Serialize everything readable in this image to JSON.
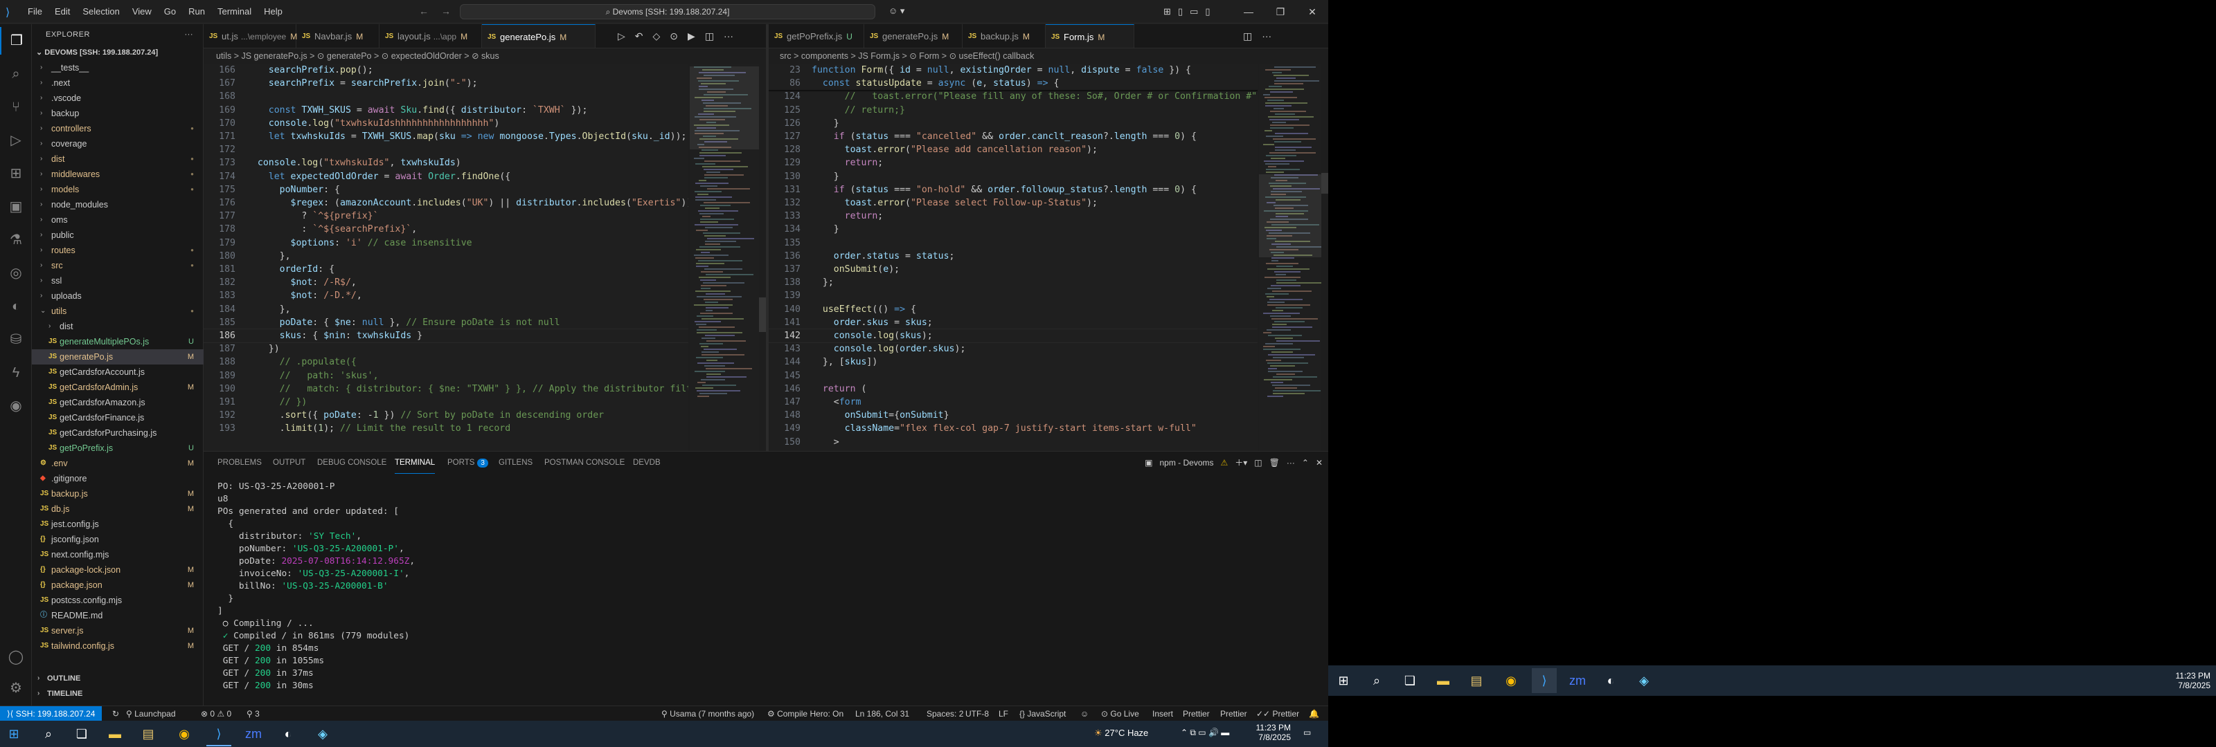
{
  "titlebar": {
    "menu": [
      "File",
      "Edit",
      "Selection",
      "View",
      "Go",
      "Run",
      "Terminal",
      "Help"
    ],
    "command_center": "Devoms [SSH: 199.188.207.24]"
  },
  "sidebar": {
    "title": "EXPLORER",
    "root": "DEVOMS [SSH: 199.188.207.24]",
    "items": [
      {
        "name": "__tests__",
        "type": "folder",
        "depth": 0,
        "badge": ""
      },
      {
        "name": ".next",
        "type": "folder",
        "depth": 0,
        "badge": ""
      },
      {
        "name": ".vscode",
        "type": "folder",
        "depth": 0,
        "badge": ""
      },
      {
        "name": "backup",
        "type": "folder",
        "depth": 0,
        "badge": ""
      },
      {
        "name": "controllers",
        "type": "folder",
        "depth": 0,
        "badge": "dot"
      },
      {
        "name": "coverage",
        "type": "folder",
        "depth": 0,
        "badge": ""
      },
      {
        "name": "dist",
        "type": "folder",
        "depth": 0,
        "badge": "dot"
      },
      {
        "name": "middlewares",
        "type": "folder",
        "depth": 0,
        "badge": "dot"
      },
      {
        "name": "models",
        "type": "folder",
        "depth": 0,
        "badge": "dot"
      },
      {
        "name": "node_modules",
        "type": "folder",
        "depth": 0,
        "badge": ""
      },
      {
        "name": "oms",
        "type": "folder",
        "depth": 0,
        "badge": ""
      },
      {
        "name": "public",
        "type": "folder",
        "depth": 0,
        "badge": ""
      },
      {
        "name": "routes",
        "type": "folder",
        "depth": 0,
        "badge": "dot"
      },
      {
        "name": "src",
        "type": "folder",
        "depth": 0,
        "badge": "dot"
      },
      {
        "name": "ssl",
        "type": "folder",
        "depth": 0,
        "badge": ""
      },
      {
        "name": "uploads",
        "type": "folder",
        "depth": 0,
        "badge": ""
      },
      {
        "name": "utils",
        "type": "folder-open",
        "depth": 0,
        "badge": "dot"
      },
      {
        "name": "dist",
        "type": "folder",
        "depth": 1,
        "badge": ""
      },
      {
        "name": "generateMultiplePOs.js",
        "type": "js",
        "depth": 1,
        "badge": "U"
      },
      {
        "name": "generatePo.js",
        "type": "js",
        "depth": 1,
        "badge": "M"
      },
      {
        "name": "getCardsforAccount.js",
        "type": "js",
        "depth": 1,
        "badge": ""
      },
      {
        "name": "getCardsforAdmin.js",
        "type": "js",
        "depth": 1,
        "badge": "M"
      },
      {
        "name": "getCardsforAmazon.js",
        "type": "js",
        "depth": 1,
        "badge": ""
      },
      {
        "name": "getCardsforFinance.js",
        "type": "js",
        "depth": 1,
        "badge": ""
      },
      {
        "name": "getCardsforPurchasing.js",
        "type": "js",
        "depth": 1,
        "badge": ""
      },
      {
        "name": "getPoPrefix.js",
        "type": "js",
        "depth": 1,
        "badge": "U"
      },
      {
        "name": ".env",
        "type": "env",
        "depth": 0,
        "badge": "M"
      },
      {
        "name": ".gitignore",
        "type": "git",
        "depth": 0,
        "badge": ""
      },
      {
        "name": "backup.js",
        "type": "js",
        "depth": 0,
        "badge": "M"
      },
      {
        "name": "db.js",
        "type": "js",
        "depth": 0,
        "badge": "M"
      },
      {
        "name": "jest.config.js",
        "type": "js",
        "depth": 0,
        "badge": ""
      },
      {
        "name": "jsconfig.json",
        "type": "json",
        "depth": 0,
        "badge": ""
      },
      {
        "name": "next.config.mjs",
        "type": "js",
        "depth": 0,
        "badge": ""
      },
      {
        "name": "package-lock.json",
        "type": "json",
        "depth": 0,
        "badge": "M"
      },
      {
        "name": "package.json",
        "type": "json",
        "depth": 0,
        "badge": "M"
      },
      {
        "name": "postcss.config.mjs",
        "type": "js",
        "depth": 0,
        "badge": ""
      },
      {
        "name": "README.md",
        "type": "md",
        "depth": 0,
        "badge": ""
      },
      {
        "name": "server.js",
        "type": "js",
        "depth": 0,
        "badge": "M"
      },
      {
        "name": "tailwind.config.js",
        "type": "js",
        "depth": 0,
        "badge": "M"
      }
    ],
    "outline": "OUTLINE",
    "timeline": "TIMELINE"
  },
  "left_editor": {
    "tabs": [
      {
        "label": "ut.js",
        "extra": "...\\employee",
        "status": "M",
        "active": false
      },
      {
        "label": "Navbar.js",
        "extra": "",
        "status": "M",
        "active": false
      },
      {
        "label": "layout.js",
        "extra": "...\\app",
        "status": "M",
        "active": false
      },
      {
        "label": "generatePo.js",
        "extra": "",
        "status": "M",
        "active": true
      }
    ],
    "breadcrumb": "utils > JS generatePo.js > ⊙ generatePo > ⊙ expectedOldOrder > ⊘ skus",
    "lines": [
      {
        "n": "166",
        "h": "    <span class='v'>searchPrefix</span>.<span class='f'>pop</span>();"
      },
      {
        "n": "167",
        "h": "    <span class='v'>searchPrefix</span> = <span class='v'>searchPrefix</span>.<span class='f'>join</span>(<span class='s'>\"-\"</span>);"
      },
      {
        "n": "168",
        "h": ""
      },
      {
        "n": "169",
        "h": "    <span class='k'>const</span> <span class='v'>TXWH_SKUS</span> = <span class='p'>await</span> <span class='t'>Sku</span>.<span class='f'>find</span>({ <span class='v'>distributor</span>: <span class='s'>`TXWH`</span> });"
      },
      {
        "n": "170",
        "h": "    <span class='v'>console</span>.<span class='f'>log</span>(<span class='s'>\"txwhskuIdshhhhhhhhhhhhhhhhh\"</span>)"
      },
      {
        "n": "171",
        "h": "    <span class='k'>let</span> <span class='v'>txwhskuIds</span> = <span class='v'>TXWH_SKUS</span>.<span class='f'>map</span>(<span class='v'>sku</span> <span class='k'>=&gt;</span> <span class='k'>new</span> <span class='v'>mongoose</span>.<span class='v'>Types</span>.<span class='f'>ObjectId</span>(<span class='v'>sku</span>.<span class='v'>_id</span>));"
      },
      {
        "n": "172",
        "h": ""
      },
      {
        "n": "173",
        "h": "  <span class='v'>console</span>.<span class='f'>log</span>(<span class='s'>\"txwhskuIds\"</span>, <span class='v'>txwhskuIds</span>)"
      },
      {
        "n": "174",
        "h": "    <span class='k'>let</span> <span class='v'>expectedOldOrder</span> = <span class='p'>await</span> <span class='t'>Order</span>.<span class='f'>findOne</span>({"
      },
      {
        "n": "175",
        "h": "      <span class='v'>poNumber</span>: {"
      },
      {
        "n": "176",
        "h": "        <span class='v'>$regex</span>: (<span class='v'>amazonAccount</span>.<span class='f'>includes</span>(<span class='s'>\"UK\"</span>) || <span class='v'>distributor</span>.<span class='f'>includes</span>(<span class='s'>\"Exertis\"</span>))"
      },
      {
        "n": "177",
        "h": "          ? <span class='s'>`^${prefix}`</span>"
      },
      {
        "n": "178",
        "h": "          : <span class='s'>`^${searchPrefix}`</span>,"
      },
      {
        "n": "179",
        "h": "        <span class='v'>$options</span>: <span class='s'>'i'</span> <span class='c'>// case insensitive</span>"
      },
      {
        "n": "180",
        "h": "      },"
      },
      {
        "n": "181",
        "h": "      <span class='v'>orderId</span>: {"
      },
      {
        "n": "182",
        "h": "        <span class='v'>$not</span>: <span class='s'>/-R$/</span>,"
      },
      {
        "n": "183",
        "h": "        <span class='v'>$not</span>: <span class='s'>/-D.*/</span>,"
      },
      {
        "n": "184",
        "h": "      },"
      },
      {
        "n": "185",
        "h": "      <span class='v'>poDate</span>: { <span class='v'>$ne</span>: <span class='k'>null</span> }, <span class='c'>// Ensure poDate is not null</span>"
      },
      {
        "n": "186",
        "h": "      <span class='v'>skus</span>: { <span class='v'>$nin</span>: <span class='v'>txwhskuIds</span> }"
      },
      {
        "n": "187",
        "h": "    })"
      },
      {
        "n": "188",
        "h": "      <span class='c'>// .populate({</span>"
      },
      {
        "n": "189",
        "h": "      <span class='c'>//   path: 'skus',</span>"
      },
      {
        "n": "190",
        "h": "      <span class='c'>//   match: { distributor: { $ne: \"TXWH\" } }, // Apply the distributor filter</span>"
      },
      {
        "n": "191",
        "h": "      <span class='c'>// })</span>"
      },
      {
        "n": "192",
        "h": "      .<span class='f'>sort</span>({ <span class='v'>poDate</span>: -<span class='n'>1</span> }) <span class='c'>// Sort by poDate in descending order</span>"
      },
      {
        "n": "193",
        "h": "      .<span class='f'>limit</span>(<span class='n'>1</span>); <span class='c'>// Limit the result to 1 record</span>"
      }
    ],
    "current_line": "186"
  },
  "right_editor": {
    "tabs": [
      {
        "label": "getPoPrefix.js",
        "extra": "",
        "status": "U",
        "active": false
      },
      {
        "label": "generatePo.js",
        "extra": "",
        "status": "M",
        "active": false
      },
      {
        "label": "backup.js",
        "extra": "",
        "status": "M",
        "active": false
      },
      {
        "label": "Form.js",
        "extra": "",
        "status": "M",
        "active": true
      }
    ],
    "breadcrumb": "src > components > JS Form.js > ⊙ Form > ⊙ useEffect() callback",
    "sticky": [
      {
        "n": "23",
        "h": "<span class='k'>function</span> <span class='f'>Form</span>({ <span class='v'>id</span> = <span class='k'>null</span>, <span class='v'>existingOrder</span> = <span class='k'>null</span>, <span class='v'>dispute</span> = <span class='k'>false</span> }) {"
      },
      {
        "n": "86",
        "h": "  <span class='k'>const</span> <span class='f'>statusUpdate</span> = <span class='k'>async</span> (<span class='v'>e</span>, <span class='v'>status</span>) <span class='k'>=&gt;</span> {"
      }
    ],
    "lines": [
      {
        "n": "124",
        "h": "      <span class='c'>//   toast.error(\"Please fill any of these: So#, Order # or Confirmation #\")</span>"
      },
      {
        "n": "125",
        "h": "      <span class='c'>// return;}</span>"
      },
      {
        "n": "126",
        "h": "    }"
      },
      {
        "n": "127",
        "h": "    <span class='p'>if</span> (<span class='v'>status</span> === <span class='s'>\"cancelled\"</span> &amp;&amp; <span class='v'>order</span>.<span class='v'>canclt_reason</span>?.<span class='v'>length</span> === <span class='n'>0</span>) {"
      },
      {
        "n": "128",
        "h": "      <span class='v'>toast</span>.<span class='f'>error</span>(<span class='s'>\"Please add cancellation reason\"</span>);"
      },
      {
        "n": "129",
        "h": "      <span class='p'>return</span>;"
      },
      {
        "n": "130",
        "h": "    }"
      },
      {
        "n": "131",
        "h": "    <span class='p'>if</span> (<span class='v'>status</span> === <span class='s'>\"on-hold\"</span> &amp;&amp; <span class='v'>order</span>.<span class='v'>followup_status</span>?.<span class='v'>length</span> === <span class='n'>0</span>) {"
      },
      {
        "n": "132",
        "h": "      <span class='v'>toast</span>.<span class='f'>error</span>(<span class='s'>\"Please select Follow-up-Status\"</span>);"
      },
      {
        "n": "133",
        "h": "      <span class='p'>return</span>;"
      },
      {
        "n": "134",
        "h": "    }"
      },
      {
        "n": "135",
        "h": ""
      },
      {
        "n": "136",
        "h": "    <span class='v'>order</span>.<span class='v'>status</span> = <span class='v'>status</span>;"
      },
      {
        "n": "137",
        "h": "    <span class='f'>onSubmit</span>(<span class='v'>e</span>);"
      },
      {
        "n": "138",
        "h": "  };"
      },
      {
        "n": "139",
        "h": ""
      },
      {
        "n": "140",
        "h": "  <span class='f'>useEffect</span>(() <span class='k'>=&gt;</span> {"
      },
      {
        "n": "141",
        "h": "    <span class='v'>order</span>.<span class='v'>skus</span> = <span class='v'>skus</span>;"
      },
      {
        "n": "142",
        "h": "    <span class='v'>console</span>.<span class='f'>log</span>(<span class='v'>skus</span>);"
      },
      {
        "n": "143",
        "h": "    <span class='v'>console</span>.<span class='f'>log</span>(<span class='v'>order</span>.<span class='v'>skus</span>);"
      },
      {
        "n": "144",
        "h": "  }, [<span class='v'>skus</span>])"
      },
      {
        "n": "145",
        "h": ""
      },
      {
        "n": "146",
        "h": "  <span class='p'>return</span> ("
      },
      {
        "n": "147",
        "h": "    &lt;<span class='k'>form</span>"
      },
      {
        "n": "148",
        "h": "      <span class='v'>onSubmit</span>={<span class='v'>onSubmit</span>}"
      },
      {
        "n": "149",
        "h": "      <span class='v'>className</span>=<span class='s'>\"flex flex-col gap-7 justify-start items-start w-full\"</span>"
      },
      {
        "n": "150",
        "h": "    &gt;"
      }
    ],
    "current_line": "142"
  },
  "panel": {
    "tabs": [
      "PROBLEMS",
      "OUTPUT",
      "DEBUG CONSOLE",
      "TERMINAL",
      "PORTS",
      "GITLENS",
      "POSTMAN CONSOLE",
      "DEVDB"
    ],
    "active_tab": "TERMINAL",
    "ports_badge": "3",
    "terminal_name": "npm - Devoms",
    "terminal_lines": [
      {
        "h": "PO: US-Q3-25-A200001-P"
      },
      {
        "h": "u8"
      },
      {
        "h": "POs generated and order updated: ["
      },
      {
        "h": "  {"
      },
      {
        "h": "    distributor: <span class='tgr'>'SY Tech'</span>,"
      },
      {
        "h": "    poNumber: <span class='tgr'>'US-Q3-25-A200001-P'</span>,"
      },
      {
        "h": "    poDate: <span class='tm'>2025-07-08T16:14:12.965Z</span>,"
      },
      {
        "h": "    invoiceNo: <span class='tgr'>'US-Q3-25-A200001-I'</span>,"
      },
      {
        "h": "    billNo: <span class='tgr'>'US-Q3-25-A200001-B'</span>"
      },
      {
        "h": "  }"
      },
      {
        "h": "]"
      },
      {
        "h": " <span style='color:#fff'>○</span> Compiling / ..."
      },
      {
        "h": " <span class='tgr'>✓</span> Compiled / in 861ms (779 modules)"
      },
      {
        "h": " GET / <span class='tgr'>200</span> in 854ms"
      },
      {
        "h": " GET / <span class='tgr'>200</span> in 1055ms"
      },
      {
        "h": " GET / <span class='tgr'>200</span> in 37ms"
      },
      {
        "h": " GET / <span class='tgr'>200</span> in 30ms"
      }
    ]
  },
  "statusbar": {
    "remote": "SSH: 199.188.207.24",
    "launchpad": "Launchpad",
    "problems": "⊗ 0 ⚠ 0",
    "ports": "⚲ 3",
    "blame": "Usama (7 months ago)",
    "compile": "Compile Hero: On",
    "position": "Ln 186, Col 31",
    "spaces": "Spaces: 2",
    "encoding": "UTF-8",
    "eol": "LF",
    "language": "JavaScript",
    "golive": "Go Live",
    "insert": "Insert",
    "prettier1": "Prettier",
    "prettier2": "Prettier",
    "prettier3": "Prettier"
  },
  "taskbar_left": {
    "weather": "27°C Haze",
    "time": "11:23 PM",
    "date": "7/8/2025"
  },
  "taskbar_right": {
    "time": "11:23 PM",
    "date": "7/8/2025"
  }
}
